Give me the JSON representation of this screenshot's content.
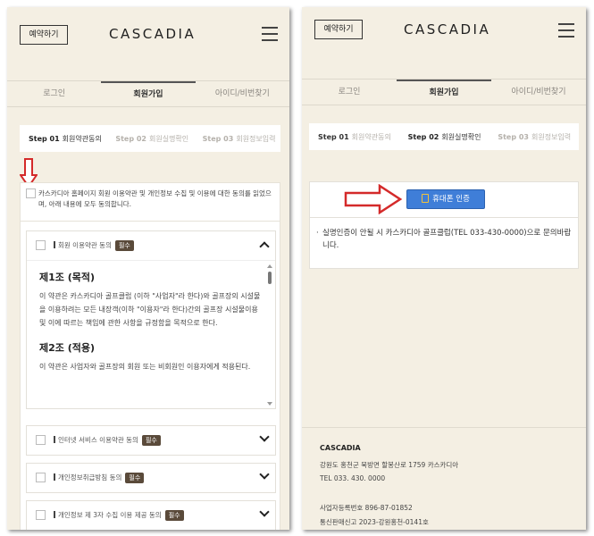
{
  "left": {
    "header": {
      "reserve_label": "예약하기",
      "brand": "CASCADIA"
    },
    "tabs": [
      {
        "label": "로그인",
        "active": false
      },
      {
        "label": "회원가입",
        "active": true
      },
      {
        "label": "아이디/비번찾기",
        "active": false
      }
    ],
    "steps": [
      {
        "num": "Step 01",
        "label": "회원약관동의",
        "active": true
      },
      {
        "num": "Step 02",
        "label": "회원실명확인",
        "active": false
      },
      {
        "num": "Step 03",
        "label": "회원정보입력",
        "active": false
      }
    ],
    "agree_all": "카스카디아 홈페이지 회원 이용약관 및 개인정보 수집 및 이용에 대한 동의를 읽었으며, 아래 내용에 모두 동의합니다.",
    "required_badge": "필수",
    "terms": [
      {
        "title": "회원 이용약관 동의",
        "expanded": true
      },
      {
        "title": "인터넷 서비스 이용약관 동의",
        "expanded": false
      },
      {
        "title": "개인정보취급방침 동의",
        "expanded": false
      },
      {
        "title": "개인정보 제 3자 수집 이용 제공 동의",
        "expanded": false
      }
    ],
    "articles": [
      {
        "title": "제1조 (목적)",
        "text": "이 약관은 카스카디아 골프클럽 (이하 \"사업자\"라 한다)와 골프장의 시설물을 이용하려는 모든 내장객(이하 \"이용자\"라 한다)간의 골프장 시설물이용 및 이에 따르는 책임에 관한 사항을 규정함을 목적으로 한다."
      },
      {
        "title": "제2조 (적용)",
        "text": "이 약관은 사업자와 골프장의 회원 또는 비회원인 이용자에게 적용된다."
      }
    ]
  },
  "right": {
    "header": {
      "reserve_label": "예약하기",
      "brand": "CASCADIA"
    },
    "tabs": [
      {
        "label": "로그인",
        "active": false
      },
      {
        "label": "회원가입",
        "active": true
      },
      {
        "label": "아이디/비번찾기",
        "active": false
      }
    ],
    "steps": [
      {
        "num": "Step 01",
        "label": "회원약관동의",
        "active": false
      },
      {
        "num": "Step 02",
        "label": "회원실명확인",
        "active": true
      },
      {
        "num": "Step 03",
        "label": "회원정보입력",
        "active": false
      }
    ],
    "phone_button": "휴대폰 인증",
    "notice": "실명인증이 안될 시 카스카디아 골프클럽(TEL 033-430-0000)으로 문의바랍니다.",
    "footer": {
      "name": "CASCADIA",
      "address": "강원도 홍천군 북방면 할봉산로 1759 카스카디아",
      "tel": "TEL 033. 430. 0000",
      "biz_no": "사업자등록번호 896-87-01852",
      "mail_order": "통신판매신고 2023-강원홍천-0141호"
    }
  },
  "colors": {
    "background": "#f4efe3",
    "button": "#3f7ed8",
    "badge": "#5a4a3a",
    "arrow": "#d42a2a"
  },
  "icons": [
    "menu-icon",
    "chevron-up-icon",
    "chevron-down-icon",
    "phone-icon",
    "red-arrow-down-icon",
    "red-arrow-right-icon"
  ]
}
